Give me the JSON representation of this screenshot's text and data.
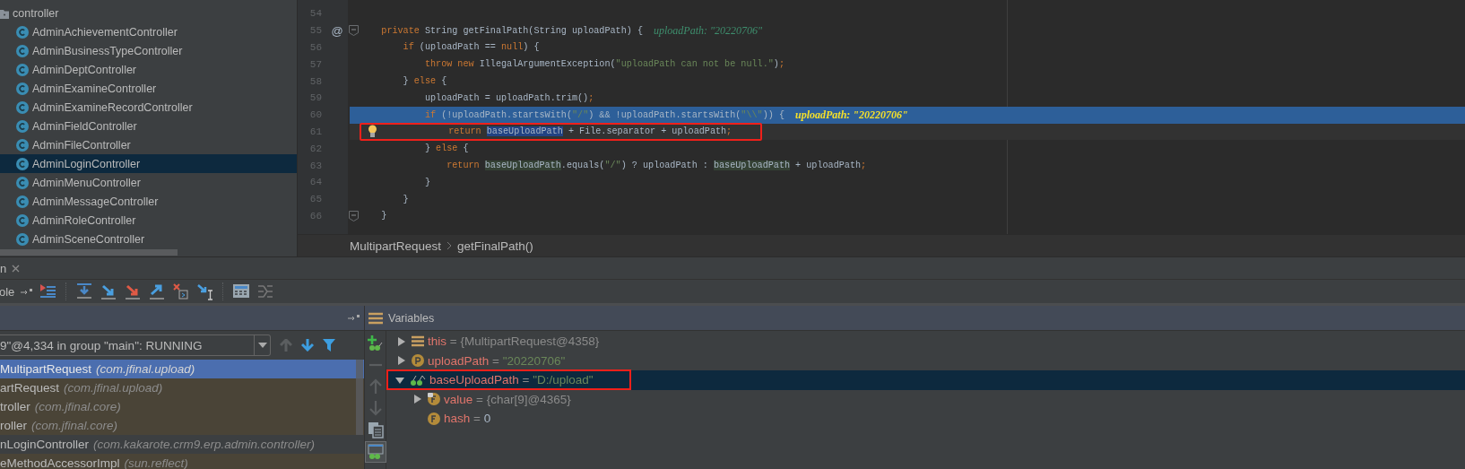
{
  "project_tree": {
    "folder": "controller",
    "items": [
      {
        "label": "AdminAchievementController",
        "selected": false
      },
      {
        "label": "AdminBusinessTypeController",
        "selected": false
      },
      {
        "label": "AdminDeptController",
        "selected": false
      },
      {
        "label": "AdminExamineController",
        "selected": false
      },
      {
        "label": "AdminExamineRecordController",
        "selected": false
      },
      {
        "label": "AdminFieldController",
        "selected": false
      },
      {
        "label": "AdminFileController",
        "selected": false
      },
      {
        "label": "AdminLoginController",
        "selected": true
      },
      {
        "label": "AdminMenuController",
        "selected": false
      },
      {
        "label": "AdminMessageController",
        "selected": false
      },
      {
        "label": "AdminRoleController",
        "selected": false
      },
      {
        "label": "AdminSceneController",
        "selected": false
      }
    ]
  },
  "editor": {
    "lines": [
      {
        "number": "54",
        "current": false,
        "caret": false,
        "fold": false,
        "bulb": false,
        "annotated": false
      },
      {
        "number": "55",
        "marker": "@",
        "current": false,
        "caret": false,
        "fold": true,
        "bulb": false,
        "annotated": false,
        "code": [
          {
            "text": "    private",
            "kind": "keyword"
          },
          {
            "text": " String getFinalPath(String uploadPath) {",
            "kind": "plain"
          }
        ],
        "hint": "uploadPath: \"20220706\""
      },
      {
        "number": "56",
        "current": false,
        "caret": false,
        "fold": false,
        "bulb": false,
        "annotated": false,
        "code": [
          {
            "text": "        if",
            "kind": "keyword"
          },
          {
            "text": " (uploadPath == ",
            "kind": "plain"
          },
          {
            "text": "null",
            "kind": "keyword"
          },
          {
            "text": ") {",
            "kind": "plain"
          }
        ]
      },
      {
        "number": "57",
        "current": false,
        "caret": false,
        "fold": false,
        "bulb": false,
        "annotated": false,
        "code": [
          {
            "text": "            throw new",
            "kind": "keyword"
          },
          {
            "text": " IllegalArgumentException(",
            "kind": "plain"
          },
          {
            "text": "\"uploadPath can not be null.\"",
            "kind": "string"
          },
          {
            "text": ")",
            "kind": "plain"
          },
          {
            "text": ";",
            "kind": "keyword"
          }
        ]
      },
      {
        "number": "58",
        "current": false,
        "caret": false,
        "fold": false,
        "bulb": false,
        "annotated": false,
        "code": [
          {
            "text": "        } ",
            "kind": "plain"
          },
          {
            "text": "else",
            "kind": "keyword"
          },
          {
            "text": " {",
            "kind": "plain"
          }
        ]
      },
      {
        "number": "59",
        "current": false,
        "caret": false,
        "fold": false,
        "bulb": false,
        "annotated": false,
        "code": [
          {
            "text": "            uploadPath = uploadPath.trim()",
            "kind": "plain"
          },
          {
            "text": ";",
            "kind": "keyword"
          }
        ]
      },
      {
        "number": "60",
        "current": true,
        "caret": false,
        "fold": false,
        "bulb": false,
        "annotated": false,
        "code": [
          {
            "text": "            if",
            "kind": "keyword"
          },
          {
            "text": " (!uploadPath.startsWith(",
            "kind": "plain"
          },
          {
            "text": "\"/\"",
            "kind": "string"
          },
          {
            "text": ") && !uploadPath.startsWith(",
            "kind": "plain"
          },
          {
            "text": "\"\\\\\"",
            "kind": "string"
          },
          {
            "text": ")) {",
            "kind": "plain"
          }
        ],
        "hint": "uploadPath: \"20220706\""
      },
      {
        "number": "61",
        "current": false,
        "caret": true,
        "fold": false,
        "bulb": true,
        "annotated": true,
        "code": [
          {
            "text": "                return ",
            "kind": "keyword"
          },
          {
            "text": "baseUploadPath",
            "kind": "selected_field"
          },
          {
            "text": " + File.separator + uploadPath",
            "kind": "plain"
          },
          {
            "text": ";",
            "kind": "keyword"
          }
        ]
      },
      {
        "number": "62",
        "current": false,
        "caret": false,
        "fold": false,
        "bulb": false,
        "annotated": false,
        "code": [
          {
            "text": "            } ",
            "kind": "plain"
          },
          {
            "text": "else",
            "kind": "keyword"
          },
          {
            "text": " {",
            "kind": "plain"
          }
        ]
      },
      {
        "number": "63",
        "current": false,
        "caret": false,
        "fold": false,
        "bulb": false,
        "annotated": false,
        "code": [
          {
            "text": "                return ",
            "kind": "keyword"
          },
          {
            "text": "baseUploadPath",
            "kind": "field_usage"
          },
          {
            "text": ".equals(",
            "kind": "plain"
          },
          {
            "text": "\"/\"",
            "kind": "string"
          },
          {
            "text": ") ? uploadPath : ",
            "kind": "plain"
          },
          {
            "text": "baseUploadPath",
            "kind": "field_usage"
          },
          {
            "text": " + uploadPath",
            "kind": "plain"
          },
          {
            "text": ";",
            "kind": "keyword"
          }
        ]
      },
      {
        "number": "64",
        "current": false,
        "caret": false,
        "fold": false,
        "bulb": false,
        "annotated": false,
        "code": [
          {
            "text": "            }",
            "kind": "plain"
          }
        ]
      },
      {
        "number": "65",
        "current": false,
        "caret": false,
        "fold": false,
        "bulb": false,
        "annotated": false,
        "code": [
          {
            "text": "        }",
            "kind": "plain"
          }
        ]
      },
      {
        "number": "66",
        "current": false,
        "caret": false,
        "fold": true,
        "bulb": false,
        "annotated": false,
        "code": [
          {
            "text": "    }",
            "kind": "plain"
          }
        ]
      }
    ]
  },
  "breadcrumbs": [
    "MultipartRequest",
    "getFinalPath()"
  ],
  "tool_tab": {
    "label": "n"
  },
  "debug_toolbar": {
    "label": "ole"
  },
  "frames": {
    "thread": "9\"@4,334 in group \"main\": RUNNING",
    "items": [
      {
        "method": "MultipartRequest",
        "location": "(com.jfinal.upload)",
        "kind": "library",
        "selected": true
      },
      {
        "method": "artRequest",
        "location": "(com.jfinal.upload)",
        "kind": "library",
        "selected": false
      },
      {
        "method": "troller",
        "location": "(com.jfinal.core)",
        "kind": "library",
        "selected": false
      },
      {
        "method": "roller",
        "location": "(com.jfinal.core)",
        "kind": "library",
        "selected": false
      },
      {
        "method": "nLoginController",
        "location": "(com.kakarote.crm9.erp.admin.controller)",
        "kind": "user",
        "selected": false
      },
      {
        "method": "eMethodAccessorImpl",
        "location": "(sun.reflect)",
        "kind": "library",
        "selected": false
      }
    ]
  },
  "variables": {
    "title": "Variables",
    "items": [
      {
        "name": "this",
        "operator": "=",
        "value": {
          "text": "{MultipartRequest@4358}",
          "kind": "object"
        },
        "kind": "object",
        "expanded": false,
        "selected": false,
        "annotated": false
      },
      {
        "name": "uploadPath",
        "operator": "=",
        "value": {
          "text": "\"20220706\"",
          "kind": "string"
        },
        "kind": "parameter",
        "expanded": false,
        "selected": false,
        "annotated": false
      },
      {
        "name": "baseUploadPath",
        "operator": "=",
        "value": {
          "text": "\"D:/upload\"",
          "kind": "string"
        },
        "kind": "watch",
        "expanded": true,
        "selected": true,
        "annotated": true,
        "children": [
          {
            "name": "value",
            "operator": "=",
            "value": {
              "text": "{char[9]@4365}",
              "kind": "object"
            },
            "kind": "final_field",
            "expanded": false,
            "selected": false,
            "annotated": false
          },
          {
            "name": "hash",
            "operator": "=",
            "value": {
              "text": "0",
              "kind": "number"
            },
            "kind": "field",
            "selected": false,
            "annotated": false
          }
        ]
      }
    ]
  }
}
